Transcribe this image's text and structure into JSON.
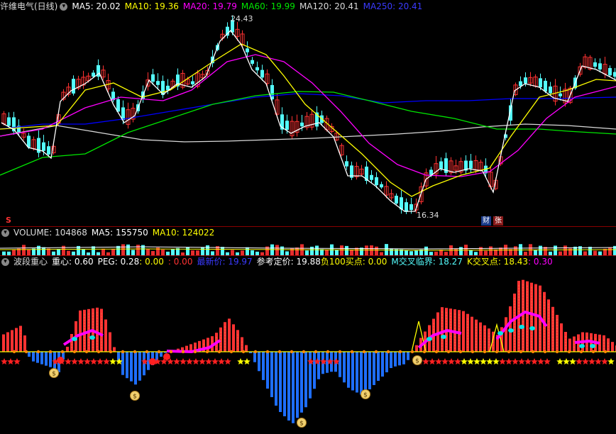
{
  "price_header": {
    "title": "许维电气(日线)",
    "ma5": "MA5: 20.02",
    "ma10": "MA10: 19.36",
    "ma20": "MA20: 19.79",
    "ma60": "MA60: 19.99",
    "ma120": "MA120: 20.41",
    "ma250": "MA250: 20.41"
  },
  "price_labels": {
    "high": "24.43",
    "low": "16.34",
    "s_marker": "S",
    "cai": "财",
    "zhang": "张"
  },
  "volume_header": {
    "volume": "VOLUME: 104868",
    "ma5": "MA5: 155750",
    "ma10": "MA10: 124022"
  },
  "indicator_header": {
    "name": "波段重心",
    "center": "重心: 0.60",
    "peg": "PEG: 0.28",
    "v1": ": 0.00",
    "v2": ": 0.00",
    "latest": "最新价: 19.97",
    "ref": "参考定价: 19.88",
    "buy": "负100买点: 0.00",
    "mcross": "M交叉临界: 18.27",
    "kcross": "K交叉点: 18.43",
    "v3": ": 0.30"
  },
  "colors": {
    "up": "#ff3232",
    "down": "#54fcfc",
    "ma5": "#ffffff",
    "ma10": "#ffff00",
    "ma20": "#ff00ff",
    "ma60": "#00e600",
    "ma120": "#d9d9d9",
    "ma250": "#0000ff",
    "sep": "#8a0000",
    "blue_bar": "#1e6eff"
  },
  "chart_data": {
    "type": "candlestick",
    "price_range": [
      15.8,
      25.2
    ],
    "high_marker": 24.43,
    "low_marker": 16.34
  }
}
